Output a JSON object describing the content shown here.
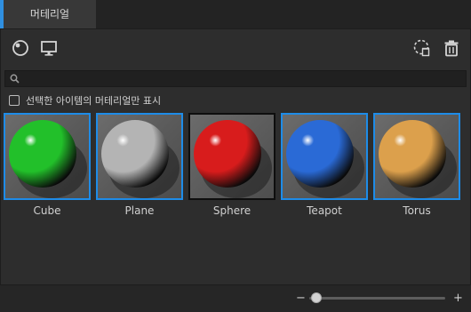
{
  "tab": {
    "label": "머테리얼"
  },
  "toolbar": {
    "left_icons": [
      "sphere-preview-icon",
      "monitor-icon"
    ],
    "right_icons": [
      "cleanup-unused-icon",
      "trash-icon"
    ]
  },
  "search": {
    "placeholder": "",
    "value": ""
  },
  "filter": {
    "label": "선택한 아이템의 머테리얼만 표시",
    "checked": false
  },
  "materials": [
    {
      "name": "Cube",
      "color": "#22c02a",
      "selected": true
    },
    {
      "name": "Plane",
      "color": "#b4b4b4",
      "selected": true
    },
    {
      "name": "Sphere",
      "color": "#d81c1c",
      "selected": false
    },
    {
      "name": "Teapot",
      "color": "#2a6ad6",
      "selected": true
    },
    {
      "name": "Torus",
      "color": "#dca04c",
      "selected": true
    }
  ],
  "zoom": {
    "level": 0.05,
    "minus_label": "−",
    "plus_label": "+"
  },
  "colors": {
    "accent": "#1e8ce8",
    "background": "#2d2d2d"
  }
}
